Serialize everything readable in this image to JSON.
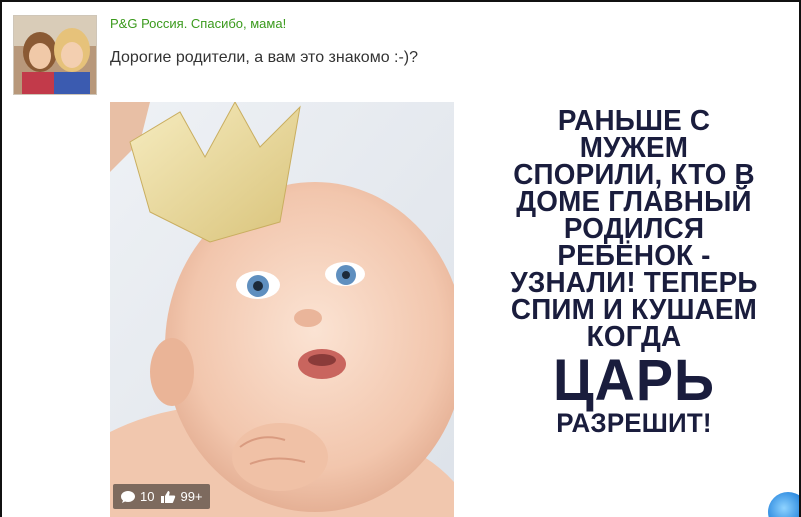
{
  "post": {
    "author": "P&G Россия. Спасибо, мама!",
    "text": "Дорогие родители, а вам это знакомо :-)?",
    "avatar_icon": "avatar-photo-icon",
    "image": {
      "caption_lines": [
        "РАНЬШЕ С",
        "МУЖЕМ",
        "СПОРИЛИ, КТО В",
        "ДОМЕ ГЛАВНЫЙ",
        "РОДИЛСЯ",
        "РЕБЁНОК -",
        "УЗНАЛИ! ТЕПЕРЬ",
        "СПИМ И КУШАЕМ",
        "КОГДА"
      ],
      "caption_big": "ЦАРЬ",
      "caption_last": "РАЗРЕШИТ!",
      "comments_count": "10",
      "likes_count": "99+",
      "comment_icon": "comment-bubble-icon",
      "like_icon": "thumbs-up-icon"
    }
  },
  "colors": {
    "author_link": "#3a9a1c",
    "caption_text": "#1a1d3d",
    "counter_bg": "#1e1e1e"
  }
}
